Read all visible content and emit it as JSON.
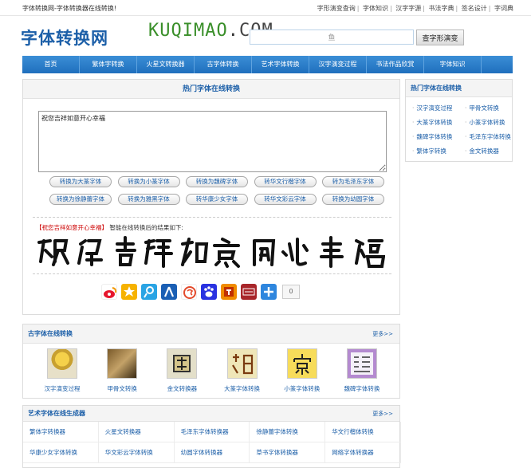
{
  "topbar": {
    "tagline": "字体转换网-字体转换器在线转换!",
    "links": [
      "字形演变查询",
      "字体知识",
      "汉字字源",
      "书法字典",
      "签名设计",
      "字词典"
    ]
  },
  "header": {
    "logo_text": "字体转换网",
    "logo_url_main": "KUQIMAO",
    "logo_url_dot": ".",
    "logo_url_tld": "COM",
    "search_value": "鱼",
    "search_button": "查字形演变"
  },
  "nav": [
    "首页",
    "繁体字转换",
    "火星文转换器",
    "古字体转换",
    "艺术字体转换",
    "汉字演变过程",
    "书法作品欣赏",
    "字体知识"
  ],
  "converter": {
    "title": "热门字体在线转换",
    "input_text": "祝您吉祥如意开心幸福",
    "buttons_row1": [
      "转换为大篆字体",
      "转换为小篆字体",
      "转换为魏碑字体",
      "转华文行楷字体",
      "转为毛泽东字体"
    ],
    "buttons_row2": [
      "转换为徐静蕾字体",
      "转换为雅黑字体",
      "转华康少女字体",
      "转华文彩云字体",
      "转换为幼圆字体"
    ],
    "result_quote": "【祝您吉祥如意开心幸福】",
    "result_suffix": "智能在线转换后的结果如下:",
    "share_count": "0"
  },
  "sidebar": {
    "title": "热门字体在线转换",
    "links": [
      "汉字演变过程",
      "甲骨文转换",
      "大篆字体转换",
      "小篆字体转换",
      "魏碑字体转换",
      "毛泽东字体转换",
      "繁体字转换",
      "金文转换器"
    ]
  },
  "ancient": {
    "title": "古字体在线转换",
    "more": "更多>>",
    "items": [
      "汉字演变过程",
      "甲骨文转换",
      "金文转换器",
      "大篆字体转换",
      "小篆字体转换",
      "魏碑字体转换"
    ]
  },
  "art": {
    "title": "艺术字体在线生成器",
    "more": "更多>>",
    "cells": [
      "繁体字转换器",
      "火星文转换器",
      "毛泽东字体转换器",
      "徐静蕾字体转换",
      "华文行楷体转换",
      "华康少女字体转换",
      "华文彩云字体转换",
      "幼圆字体转换器",
      "草书字体转换器",
      "网络字体转换器"
    ]
  },
  "colors": {
    "brand_blue": "#1c5fa8",
    "nav_blue": "#2a7ccb",
    "logo_green": "#3a8f2a"
  },
  "icons": [
    "weibo-icon",
    "qzone-star-icon",
    "tencent-weibo-icon",
    "renren-icon",
    "sohu-icon",
    "baidu-icon",
    "tianya-icon",
    "kaixin-icon",
    "more-share-icon"
  ]
}
